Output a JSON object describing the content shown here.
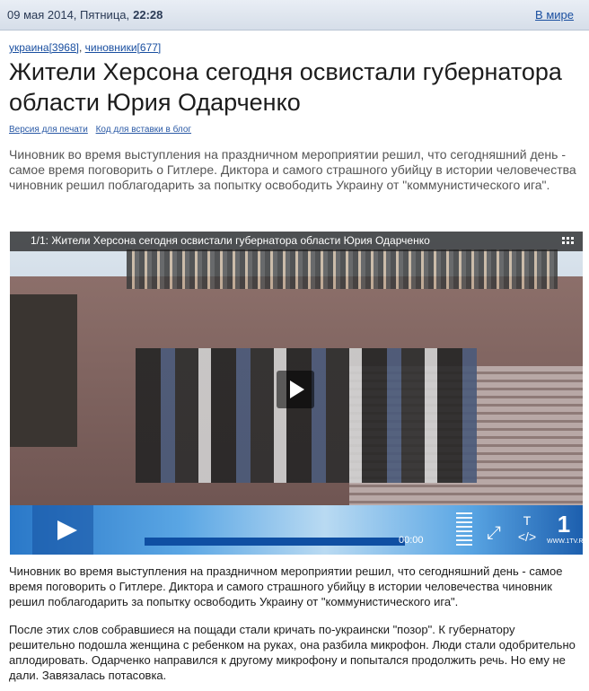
{
  "header": {
    "date": "09 мая 2014, Пятница,",
    "time": "22:28",
    "world_link": "В мире"
  },
  "tags": [
    {
      "label": "украина[3968]"
    },
    {
      "label": "чиновники[677]"
    }
  ],
  "title": "Жители Херсона сегодня освистали губернатора области Юрия Одарченко",
  "links": {
    "print": "Версия для печати",
    "blog": "Код для вставки в блог"
  },
  "lead": "Чиновник во время выступления на праздничном мероприятии решил, что сегодняшний день - самое время поговорить о Гитлере. Диктора и самого страшного убийцу в истории человечества чиновник решил поблагодарить за попытку освободить Украину от \"коммунистического ига\".",
  "player": {
    "title": "1/1: Жители Херсона сегодня освистали губернатора области Юрия Одарченко",
    "time": "00:00",
    "text_btn": "T",
    "code_btn": "</>",
    "logo": "1",
    "logo_sub": "WWW.1TV.RU"
  },
  "body": {
    "p1": "Чиновник во время выступления на праздничном мероприятии решил, что сегодняшний день - самое время поговорить о Гитлере. Диктора и самого страшного убийцу в истории человечества чиновник решил поблагодарить за попытку освободить Украину от \"коммунистического ига\".",
    "p2": "После этих слов собравшиеся на пощади стали кричать по-украински \"позор\". К губернатору решительно подошла женщина с ребенком на руках, она разбила микрофон. Люди стали одобрительно аплодировать. Одарченко направился к другому микрофону и попытался продолжить речь. Но ему не дали. Завязалась потасовка."
  }
}
